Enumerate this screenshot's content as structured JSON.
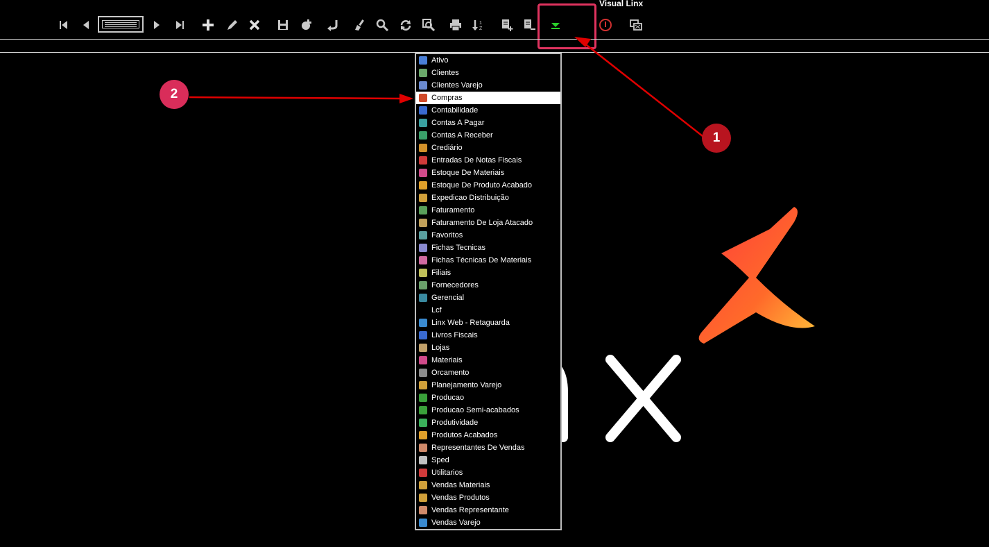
{
  "window": {
    "title": "Visual Linx"
  },
  "toolbar": {
    "buttons": [
      {
        "name": "first-record-button",
        "icon": "first-icon"
      },
      {
        "name": "previous-record-button",
        "icon": "previous-icon"
      },
      {
        "name": "next-record-button",
        "icon": "next-icon"
      },
      {
        "name": "last-record-button",
        "icon": "last-icon"
      },
      {
        "name": "add-button",
        "icon": "plus-icon"
      },
      {
        "name": "edit-button",
        "icon": "pencil-icon"
      },
      {
        "name": "delete-button",
        "icon": "x-icon"
      },
      {
        "name": "save-button",
        "icon": "save-icon"
      },
      {
        "name": "copy-button",
        "icon": "copy-icon"
      },
      {
        "name": "undo-button",
        "icon": "undo-icon"
      },
      {
        "name": "clear-button",
        "icon": "brush-icon"
      },
      {
        "name": "search-button",
        "icon": "search-icon"
      },
      {
        "name": "refresh-button",
        "icon": "refresh-icon"
      },
      {
        "name": "zoom-search-button",
        "icon": "zoom-icon"
      },
      {
        "name": "print-button",
        "icon": "print-icon"
      },
      {
        "name": "sort-button",
        "icon": "sort-icon"
      },
      {
        "name": "add-record-doc-button",
        "icon": "doc-plus-icon"
      },
      {
        "name": "remove-record-doc-button",
        "icon": "doc-minus-icon"
      },
      {
        "name": "modules-dropdown-button",
        "icon": "green-arrow-down-icon"
      },
      {
        "name": "stop-button",
        "icon": "stop-icon"
      },
      {
        "name": "windows-button",
        "icon": "windows-icon"
      }
    ]
  },
  "annotations": {
    "badge1": "1",
    "badge2": "2"
  },
  "menu": {
    "items": [
      {
        "label": "Ativo",
        "color": "#4a7fd6"
      },
      {
        "label": "Clientes",
        "color": "#6aa86a"
      },
      {
        "label": "Clientes Varejo",
        "color": "#6a8ad0"
      },
      {
        "label": "Compras",
        "color": "#d04a2a",
        "selected": true
      },
      {
        "label": "Contabilidade",
        "color": "#3a6ad0"
      },
      {
        "label": "Contas A Pagar",
        "color": "#3aa0a0"
      },
      {
        "label": "Contas A Receber",
        "color": "#3aa06a"
      },
      {
        "label": "Crediário",
        "color": "#d0902a"
      },
      {
        "label": "Entradas De Notas Fiscais",
        "color": "#d03a3a"
      },
      {
        "label": "Estoque De Materiais",
        "color": "#d04a8a"
      },
      {
        "label": "Estoque De Produto Acabado",
        "color": "#e0a02a"
      },
      {
        "label": "Expedicao Distribuição",
        "color": "#d0a03a"
      },
      {
        "label": "Faturamento",
        "color": "#5aa05a"
      },
      {
        "label": "Faturamento De Loja Atacado",
        "color": "#c0a05a"
      },
      {
        "label": "Favoritos",
        "color": "#5aa0a0"
      },
      {
        "label": "Fichas Tecnicas",
        "color": "#8a8ad0"
      },
      {
        "label": "Fichas Técnicas De Materiais",
        "color": "#d06aa0"
      },
      {
        "label": "Filiais",
        "color": "#c0c05a"
      },
      {
        "label": "Fornecedores",
        "color": "#6aa06a"
      },
      {
        "label": "Gerencial",
        "color": "#3a8aa0"
      },
      {
        "label": "Lcf",
        "color": "none"
      },
      {
        "label": "Linx Web - Retaguarda",
        "color": "#3a8ad0"
      },
      {
        "label": "Livros Fiscais",
        "color": "#3a6ad0"
      },
      {
        "label": "Lojas",
        "color": "#c0a06a"
      },
      {
        "label": "Materiais",
        "color": "#d04a8a"
      },
      {
        "label": "Orcamento",
        "color": "#8a8a8a"
      },
      {
        "label": "Planejamento Varejo",
        "color": "#d0a03a"
      },
      {
        "label": "Producao",
        "color": "#3aa03a"
      },
      {
        "label": "Producao Semi-acabados",
        "color": "#3aa03a"
      },
      {
        "label": "Produtividade",
        "color": "#3ab05a"
      },
      {
        "label": "Produtos Acabados",
        "color": "#e0a02a"
      },
      {
        "label": "Representantes De Vendas",
        "color": "#d08a6a"
      },
      {
        "label": "Sped",
        "color": "#c0c0c0"
      },
      {
        "label": "Utilitarios",
        "color": "#d03a3a"
      },
      {
        "label": "Vendas Materiais",
        "color": "#d0a03a"
      },
      {
        "label": "Vendas Produtos",
        "color": "#d0a03a"
      },
      {
        "label": "Vendas Representante",
        "color": "#d08a6a"
      },
      {
        "label": "Vendas Varejo",
        "color": "#3a8ad0"
      }
    ]
  },
  "colors": {
    "accent_box": "#e0335f",
    "arrow": "#e00000",
    "dropdown_green": "#2ad02a"
  }
}
